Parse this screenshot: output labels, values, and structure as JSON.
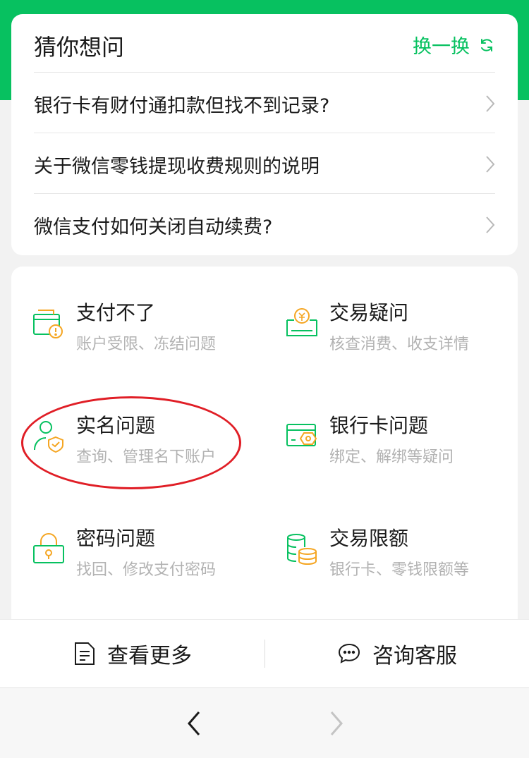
{
  "faq": {
    "title": "猜你想问",
    "refresh_label": "换一换",
    "items": [
      {
        "text": "银行卡有财付通扣款但找不到记录?"
      },
      {
        "text": "关于微信零钱提现收费规则的说明"
      },
      {
        "text": "微信支付如何关闭自动续费?"
      }
    ]
  },
  "services": [
    {
      "name": "支付不了",
      "desc": "账户受限、冻结问题",
      "icon": "payment-blocked-icon"
    },
    {
      "name": "交易疑问",
      "desc": "核查消费、收支详情",
      "icon": "transaction-query-icon"
    },
    {
      "name": "实名问题",
      "desc": "查询、管理名下账户",
      "icon": "real-name-icon"
    },
    {
      "name": "银行卡问题",
      "desc": "绑定、解绑等疑问",
      "icon": "bank-card-icon"
    },
    {
      "name": "密码问题",
      "desc": "找回、修改支付密码",
      "icon": "password-lock-icon"
    },
    {
      "name": "交易限额",
      "desc": "银行卡、零钱限额等",
      "icon": "coin-stack-icon"
    }
  ],
  "bottom": {
    "more_label": "查看更多",
    "service_label": "咨询客服"
  },
  "colors": {
    "brand_green": "#07c160",
    "accent_orange": "#f5a623",
    "annotation_red": "#e01e26"
  }
}
